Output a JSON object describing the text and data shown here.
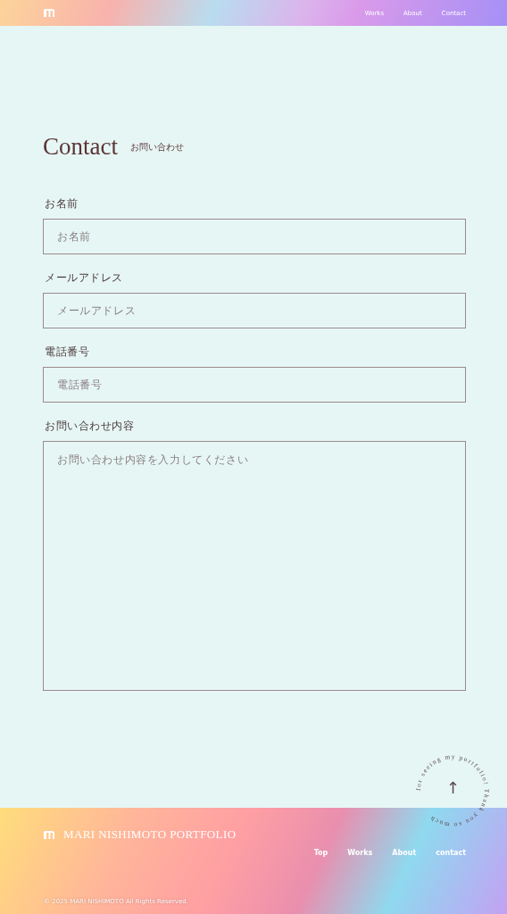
{
  "header": {
    "nav": [
      "Works",
      "About",
      "Contact"
    ]
  },
  "page": {
    "title": "Contact",
    "subtitle": "お問い合わせ"
  },
  "form": {
    "fields": [
      {
        "kind": "input",
        "label": "お名前",
        "placeholder": "お名前"
      },
      {
        "kind": "input",
        "label": "メールアドレス",
        "placeholder": "メールアドレス"
      },
      {
        "kind": "input",
        "label": "電話番号",
        "placeholder": "電話番号"
      },
      {
        "kind": "textarea",
        "label": "お問い合わせ内容",
        "placeholder": "お問い合わせ内容を入力してください"
      }
    ]
  },
  "back_to_top": {
    "circle_text": "for seeing my portfolio! Thank you so much ",
    "arrow": "↑"
  },
  "footer": {
    "title": "MARI NISHIMOTO PORTFOLIO",
    "nav": [
      "Top",
      "Works",
      "About",
      "contact"
    ],
    "copyright": "© 2025 MARI NISHIMOTO All Rights Reserved."
  }
}
